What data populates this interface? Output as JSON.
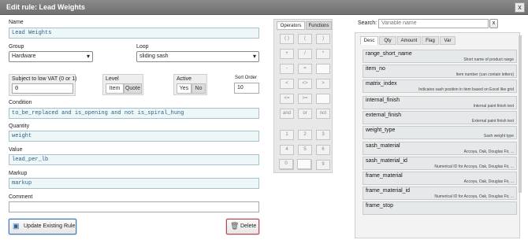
{
  "dialog": {
    "title": "Edit rule: Lead Weights",
    "close_label": "x"
  },
  "form": {
    "name_label": "Name",
    "name_value": "Lead Weights",
    "group_label": "Group",
    "group_value": "Hardware",
    "loop_label": "Loop",
    "loop_value": "sliding sash",
    "vat_label": "Subject to low VAT (0 or 1)",
    "vat_value": "0",
    "level_label": "Level",
    "level_options": [
      "Item",
      "Quote"
    ],
    "level_selected": "Quote",
    "active_label": "Active",
    "active_options": [
      "Yes",
      "No"
    ],
    "active_selected": "No",
    "sort_label": "Sort Order",
    "sort_value": "10",
    "condition_label": "Condition",
    "condition_value": "to_be_replaced and is_opening and not is_spiral_hung",
    "quantity_label": "Quantity",
    "quantity_value": "weight",
    "value_label": "Value",
    "value_value": "lead_per_lb",
    "markup_label": "Markup",
    "markup_value": "markup",
    "comment_label": "Comment",
    "comment_value": ""
  },
  "buttons": {
    "update_label": "Update Existing Rule",
    "delete_label": "Delete"
  },
  "palette": {
    "tabs": [
      "Operators",
      "Functions"
    ],
    "operator_keys": [
      "( )",
      "(",
      ")",
      "+",
      "/",
      "*",
      "-",
      "=",
      "<",
      "<>",
      ">",
      "<=",
      ">=",
      "and",
      "or",
      "not"
    ],
    "number_keys": [
      "1",
      "2",
      "3",
      "4",
      "5",
      "6",
      "7",
      "8",
      "9",
      "0",
      ""
    ]
  },
  "search": {
    "label": "Search:",
    "placeholder": "Variable name",
    "clear_label": "x"
  },
  "variables": {
    "tabs": [
      "Desc",
      "Qty",
      "Amount",
      "Flag",
      "Var"
    ],
    "active_tab": "Desc",
    "items": [
      {
        "name": "range_short_name",
        "desc": "Short name of product range"
      },
      {
        "name": "item_no",
        "desc": "Item number (can contain letters)"
      },
      {
        "name": "matrix_index",
        "desc": "Indicates sash position in item based on Excel like grid"
      },
      {
        "name": "internal_finish",
        "desc": "Internal paint finish text"
      },
      {
        "name": "external_finish",
        "desc": "External paint finish text"
      },
      {
        "name": "weight_type",
        "desc": "Sash weight type"
      },
      {
        "name": "sash_material",
        "desc": "Accoya, Oak, Douglas Fir, ..."
      },
      {
        "name": "sash_material_id",
        "desc": "Numerical ID for Accoya, Oak, Douglas Fir, ..."
      },
      {
        "name": "frame_material",
        "desc": "Accoya, Oak, Douglas Fir, ..."
      },
      {
        "name": "frame_material_id",
        "desc": "Numerical ID for Accoya, Oak, Douglas Fir, ..."
      },
      {
        "name": "frame_stop",
        "desc": ""
      }
    ]
  },
  "colors": {
    "title_bar": "#7a7a7a",
    "field_bg": "#eef7f8",
    "field_text": "#2a5f88",
    "delete_border": "#b04a55",
    "update_border": "#4a78b0"
  }
}
